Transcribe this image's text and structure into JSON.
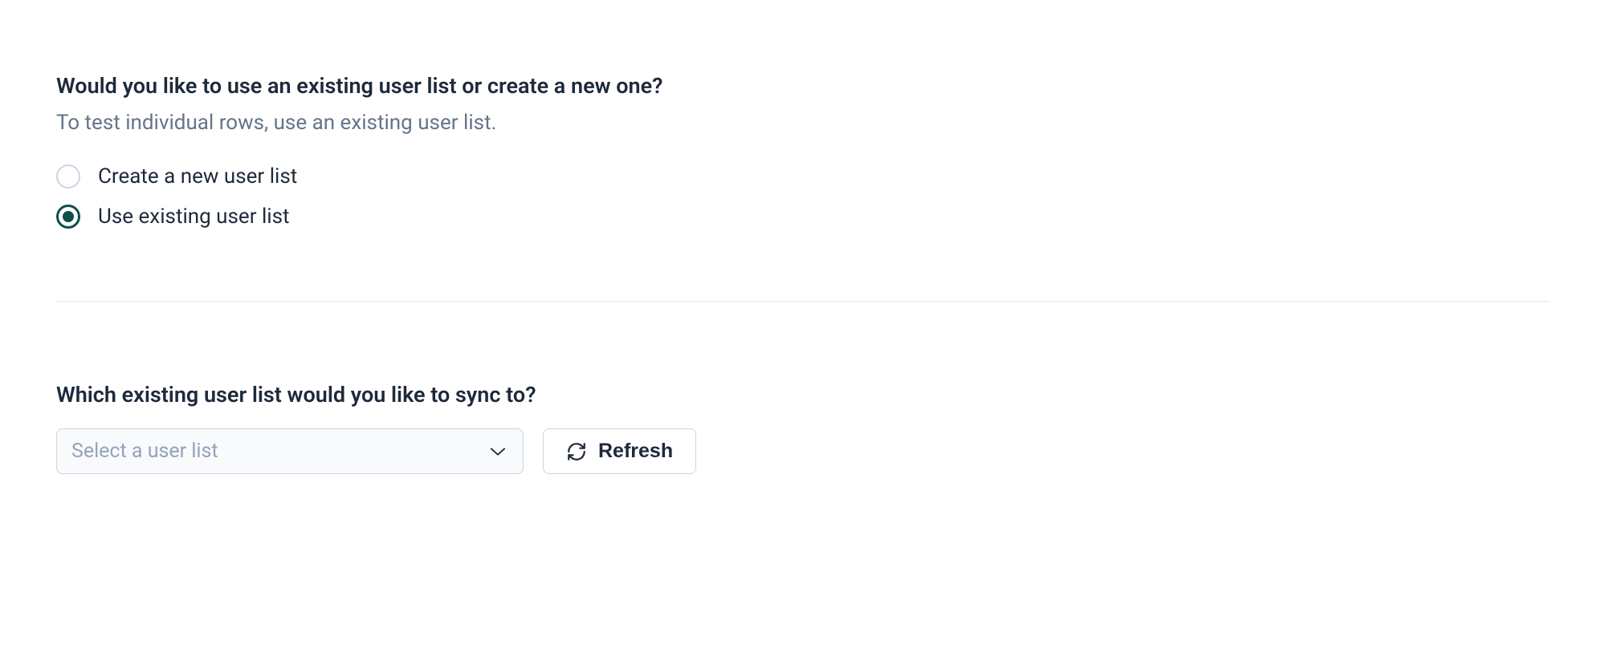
{
  "section1": {
    "heading": "Would you like to use an existing user list or create a new one?",
    "subheading": "To test individual rows, use an existing user list.",
    "options": {
      "create": "Create a new user list",
      "existing": "Use existing user list"
    }
  },
  "section2": {
    "heading": "Which existing user list would you like to sync to?",
    "select_placeholder": "Select a user list",
    "refresh_label": "Refresh"
  }
}
